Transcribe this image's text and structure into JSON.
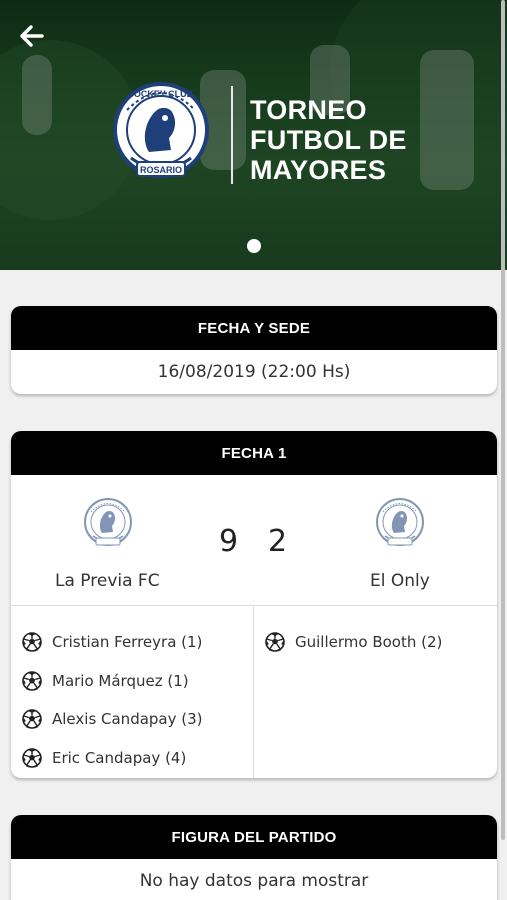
{
  "header": {
    "title_lines": [
      "TORNEO",
      "FUTBOL DE",
      "MAYORES"
    ],
    "logo_text_top": "JOCKEY CLUB",
    "logo_text_bottom": "ROSARIO",
    "carousel_pages": 1,
    "carousel_active": 1
  },
  "sede_card": {
    "heading": "FECHA Y SEDE",
    "datetime": "16/08/2019 (22:00 Hs)"
  },
  "match_card": {
    "heading": "FECHA 1",
    "home": {
      "name": "La Previa FC",
      "score": "9"
    },
    "away": {
      "name": "El Only",
      "score": "2"
    },
    "home_scorers": [
      "Cristian Ferreyra (1)",
      "Mario Márquez (1)",
      "Alexis Candapay (3)",
      "Eric Candapay (4)"
    ],
    "away_scorers": [
      "Guillermo Booth (2)"
    ]
  },
  "figura_card": {
    "heading": "FIGURA DEL PARTIDO",
    "empty_text": "No hay datos para mostrar"
  },
  "colors": {
    "card_header": "#000000",
    "hero_green": "#1f4a26",
    "page_bg": "#f0f0f0"
  },
  "icons": {
    "back": "arrow-left-icon",
    "ball": "soccer-ball-icon",
    "club": "jockey-club-logo"
  }
}
